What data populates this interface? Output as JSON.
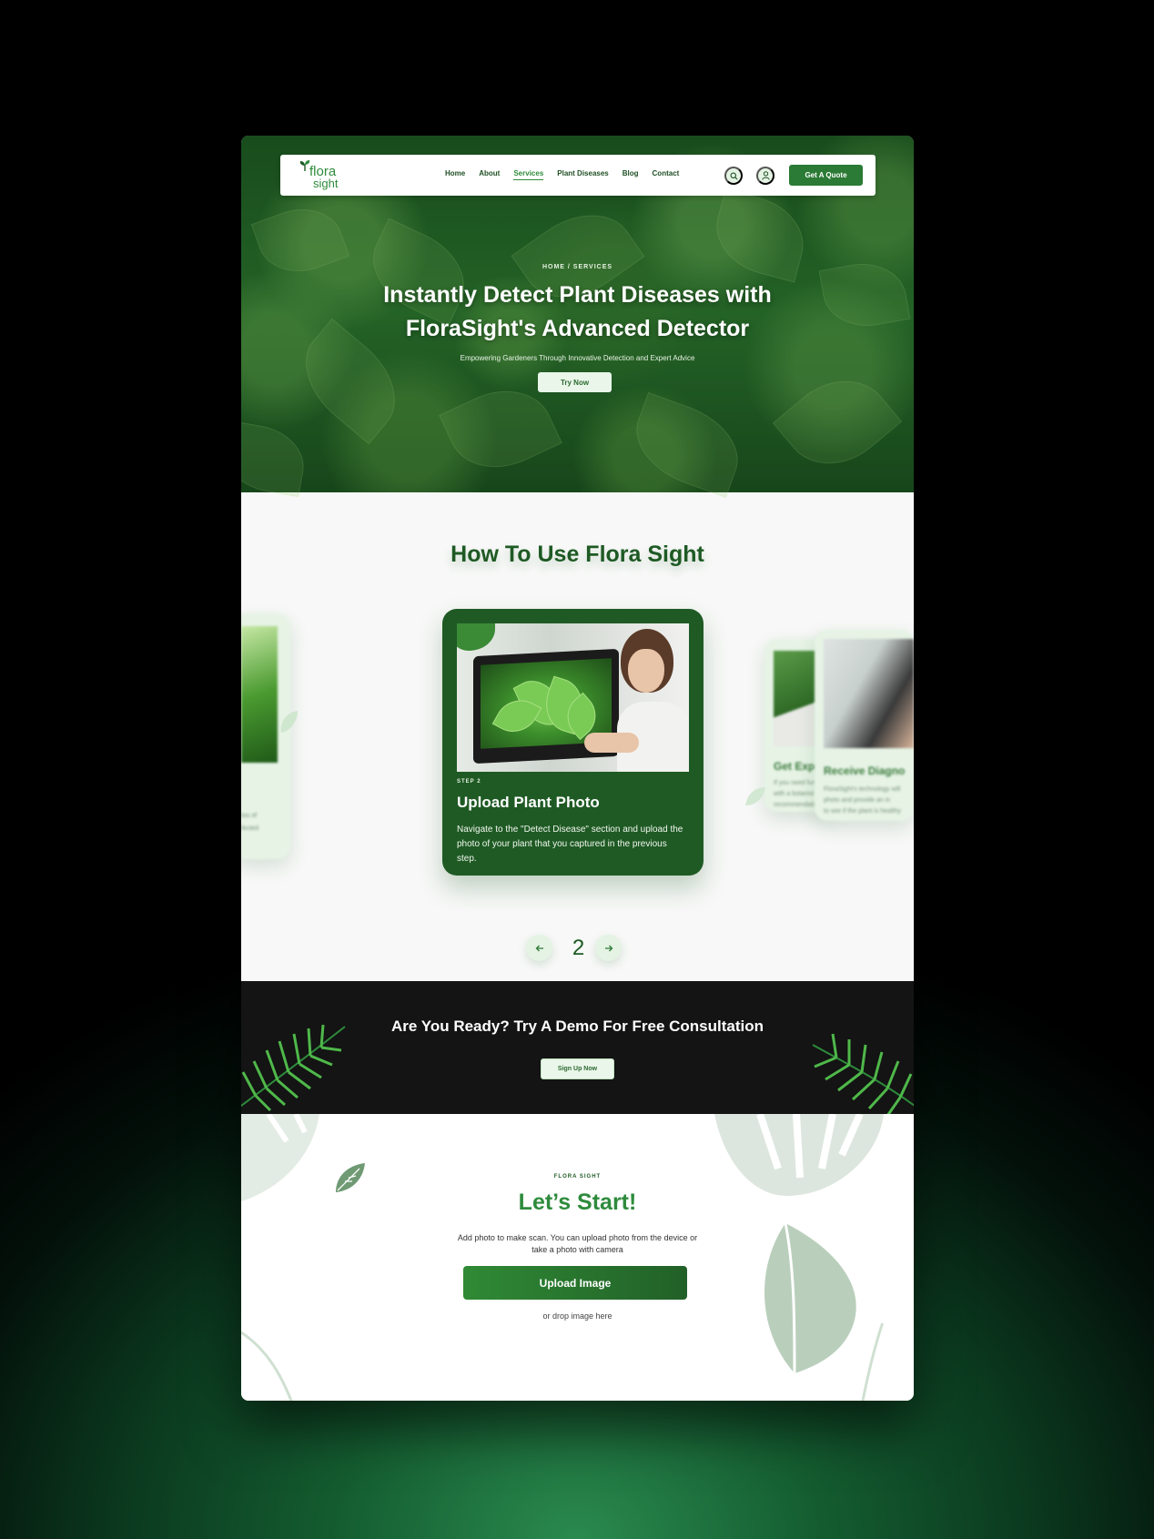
{
  "nav": {
    "logo_line1": "flora",
    "logo_line2": "sight",
    "links": [
      "Home",
      "About",
      "Services",
      "Plant Diseases",
      "Blog",
      "Contact"
    ],
    "active_link": "Services",
    "quote_button": "Get A Quote",
    "icons": [
      "search-icon",
      "user-icon"
    ]
  },
  "hero": {
    "breadcrumb": "HOME / SERVICES",
    "title": "Instantly Detect Plant Diseases with FloraSight's Advanced Detector",
    "subtitle": "Empowering Gardeners Through Innovative Detection and Expert Advice",
    "cta": "Try Now"
  },
  "howto": {
    "title": "How To Use Flora Sight",
    "active_step": {
      "label": "STEP 2",
      "title": "Upload Plant Photo",
      "description": "Navigate to the \"Detect Disease\" section and upload the photo of your plant that you captured in the previous step."
    },
    "prev_card": {
      "desc_line1": "tos of",
      "desc_line2": "fected"
    },
    "next_card_a": {
      "title": "Get Exper",
      "desc_line1": "If you need furt",
      "desc_line2": "with a botanist",
      "desc_line3": "recommendations"
    },
    "next_card_b": {
      "title": "Receive Diagno",
      "desc_line1": "FloraSight's technology will",
      "desc_line2": "photo and provide an in",
      "desc_line3": "to see if the plant is healthy"
    },
    "pager_number": "2",
    "pager_icons": [
      "arrow-left-icon",
      "arrow-right-icon"
    ]
  },
  "cta": {
    "title": "Are You Ready? Try A Demo For Free Consultation",
    "button": "Sign Up Now"
  },
  "start": {
    "eyebrow": "FLORA SIGHT",
    "title": "Let’s Start!",
    "description": "Add photo to make scan. You can upload photo from the device or take a photo with camera",
    "upload_button": "Upload Image",
    "drop_text": "or drop image here"
  },
  "colors": {
    "brand_green": "#2e8b3c",
    "dark_green": "#1f5a24",
    "light_green": "#e4f3e4",
    "cta_dark": "#131413"
  }
}
